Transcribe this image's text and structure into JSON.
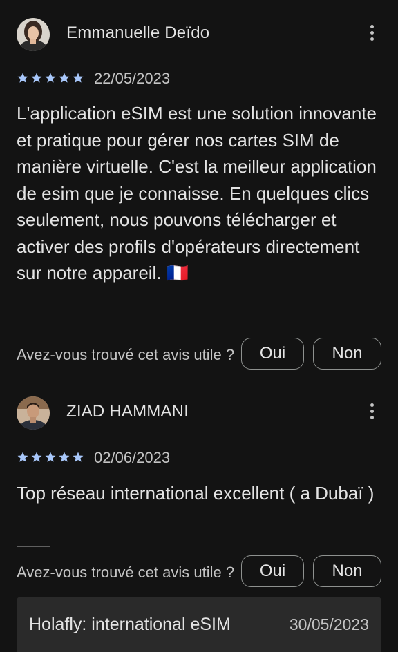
{
  "reviews": [
    {
      "author": "Emmanuelle Deïdo",
      "stars": 5,
      "date": "22/05/2023",
      "text": "L'application eSIM est une solution innovante et pratique pour gérer nos cartes SIM de manière virtuelle. C'est la meilleur application de esim que je connaisse. En quelques clics seulement, nous pouvons télécharger et activer des profils d'opérateurs directement sur notre appareil. 🇫🇷",
      "helpful_question": "Avez-vous trouvé cet avis utile ?",
      "yes_label": "Oui",
      "no_label": "Non"
    },
    {
      "author": "ZIAD HAMMANI",
      "stars": 5,
      "date": "02/06/2023",
      "text": "Top réseau international excellent ( a Dubaï )",
      "helpful_question": "Avez-vous trouvé cet avis utile ?",
      "yes_label": "Oui",
      "no_label": "Non"
    }
  ],
  "developer_reply": {
    "name": "Holafly: international eSIM",
    "date": "30/05/2023"
  },
  "colors": {
    "background": "#131313",
    "star": "#a8c7fa",
    "text": "#e3e3e3",
    "secondary_text": "#c4c4c4",
    "card": "#2a2a2a"
  },
  "icons": [
    "star-icon",
    "more-vert-icon",
    "avatar"
  ]
}
